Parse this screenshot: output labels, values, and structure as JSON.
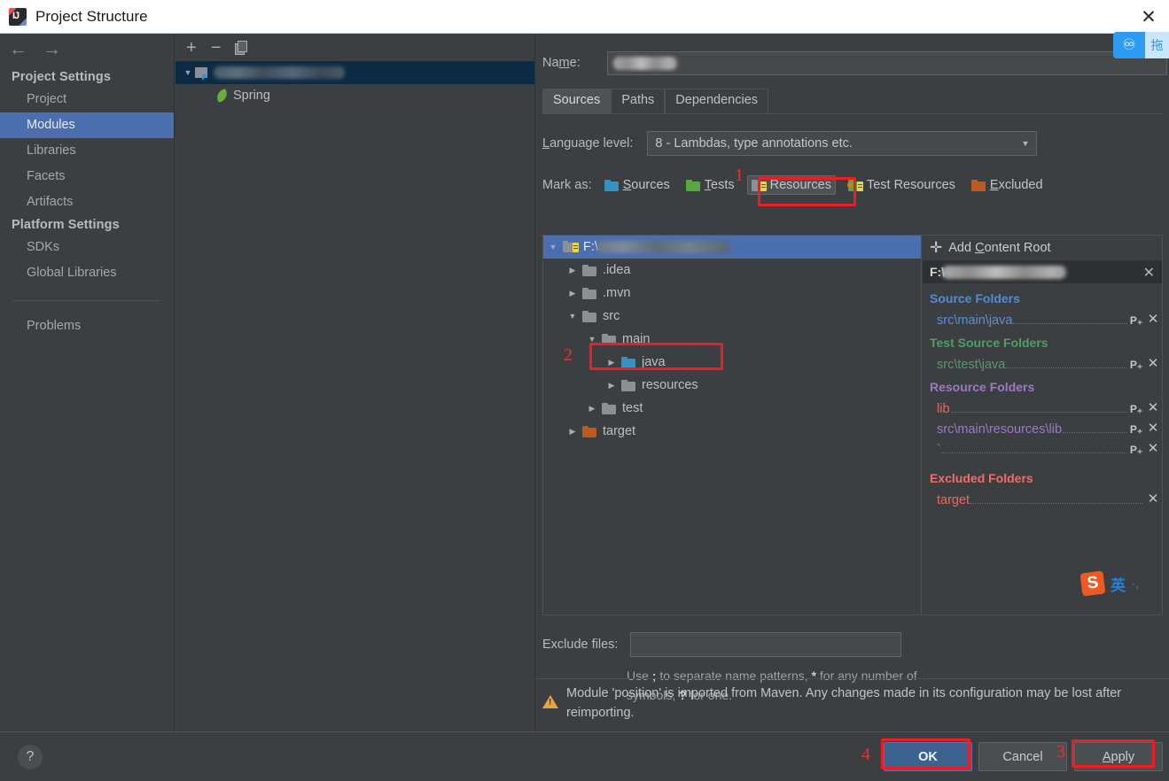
{
  "window": {
    "title": "Project Structure",
    "logo_icon": "intellij-idea-logo-icon",
    "close_icon": "close-icon"
  },
  "nav": {
    "back_icon": "arrow-left-icon",
    "forward_icon": "arrow-right-icon"
  },
  "sidebar": {
    "groups": [
      {
        "label": "Project Settings",
        "items": [
          "Project",
          "Modules",
          "Libraries",
          "Facets",
          "Artifacts"
        ]
      },
      {
        "label": "Platform Settings",
        "items": [
          "SDKs",
          "Global Libraries"
        ]
      }
    ],
    "selected": "Modules",
    "extra_items": [
      "Problems"
    ]
  },
  "module_pane": {
    "toolbar": {
      "add_icon": "plus-icon",
      "remove_icon": "minus-icon",
      "copy_icon": "copy-icon"
    },
    "tree": [
      {
        "label": "",
        "redacted": true,
        "icon": "module-icon",
        "expanded": true,
        "selected": true,
        "indent": 0
      },
      {
        "label": "Spring",
        "redacted": false,
        "icon": "spring-leaf-icon",
        "expanded": null,
        "selected": false,
        "indent": 1
      }
    ]
  },
  "main": {
    "name_label": "Na<u>m</u>e:",
    "name_value": "",
    "name_redacted": true,
    "tabs": [
      {
        "label": "Sources",
        "active": true
      },
      {
        "label": "Paths",
        "active": false
      },
      {
        "label": "Dependencies",
        "active": false
      }
    ],
    "language_level_label": "<u>L</u>anguage level:",
    "language_level_value": "8 - Lambdas, type annotations etc.",
    "mark_as_label": "Mark as:",
    "mark_as_options": [
      {
        "label": "<u>S</u>ources",
        "color": "teal",
        "pressed": false
      },
      {
        "label": "<u>T</u>ests",
        "color": "green",
        "pressed": false
      },
      {
        "label": "Resources",
        "color": "grey-lines",
        "pressed": true
      },
      {
        "label": "Test Resources",
        "color": "green-lines-dot",
        "pressed": false
      },
      {
        "label": "<u>E</u>xcluded",
        "color": "orange",
        "pressed": false
      }
    ],
    "exclude_files_label": "Exclude files:",
    "exclude_files_value": "",
    "exclude_files_hint_1": "Use ",
    "exclude_files_hint_semi": ";",
    "exclude_files_hint_2": " to separate name patterns, ",
    "exclude_files_hint_star": "*",
    "exclude_files_hint_3": " for any number of symbols, ",
    "exclude_files_hint_q": "?",
    "exclude_files_hint_4": " for one.",
    "warning_icon": "warning-triangle-icon",
    "warning_text": "Module 'position' is imported from Maven. Any changes made in its configuration may be lost after reimporting."
  },
  "content_tree": [
    {
      "label": "F:\\",
      "redacted": true,
      "icon": "content-root-icon",
      "state": "expanded",
      "indent": 0,
      "selected": true
    },
    {
      "label": ".idea",
      "icon": "folder-grey-icon",
      "state": "collapsed",
      "indent": 1,
      "selected": false
    },
    {
      "label": ".mvn",
      "icon": "folder-grey-icon",
      "state": "collapsed",
      "indent": 1,
      "selected": false
    },
    {
      "label": "src",
      "icon": "folder-grey-icon",
      "state": "expanded",
      "indent": 1,
      "selected": false
    },
    {
      "label": "main",
      "icon": "folder-grey-icon",
      "state": "expanded",
      "indent": 2,
      "selected": false
    },
    {
      "label": "java",
      "icon": "folder-teal-icon",
      "state": "collapsed",
      "indent": 3,
      "selected": false
    },
    {
      "label": "resources",
      "icon": "folder-grey-icon",
      "state": "collapsed",
      "indent": 3,
      "selected": false,
      "annotated": true
    },
    {
      "label": "test",
      "icon": "folder-grey-icon",
      "state": "collapsed",
      "indent": 2,
      "selected": false
    },
    {
      "label": "target",
      "icon": "folder-orange-icon",
      "state": "collapsed",
      "indent": 1,
      "selected": false
    }
  ],
  "roots_panel": {
    "add_content_root_label": "Add <u>C</u>ontent Root",
    "add_icon": "plus-icon",
    "content_root": {
      "prefix": "F:\\",
      "redacted": true,
      "remove_icon": "close-icon"
    },
    "groups": [
      {
        "title": "Source Folders",
        "kind": "src",
        "entries": [
          {
            "path": "src\\main\\java",
            "invalid": false,
            "has_package_prefix": true
          }
        ]
      },
      {
        "title": "Test Source Folders",
        "kind": "test",
        "entries": [
          {
            "path": "src\\test\\java",
            "invalid": false,
            "has_package_prefix": true
          }
        ]
      },
      {
        "title": "Resource Folders",
        "kind": "res",
        "entries": [
          {
            "path": "lib",
            "invalid": true,
            "has_package_prefix": true
          },
          {
            "path": "src\\main\\resources\\lib",
            "invalid": false,
            "has_package_prefix": true
          },
          {
            "path": "`",
            "invalid": false,
            "has_package_prefix": true
          }
        ]
      },
      {
        "title": "Excluded Folders",
        "kind": "exc",
        "entries": [
          {
            "path": "target",
            "invalid": false,
            "has_package_prefix": false
          }
        ]
      }
    ],
    "package_prefix_icon": "package-prefix-icon",
    "remove_icon": "close-icon"
  },
  "footer": {
    "help_label": "?",
    "ok_label": "OK",
    "cancel_label": "Cancel",
    "apply_label": "<u>A</u>pply"
  },
  "annotations": [
    {
      "number": "1",
      "target": "mark-as-resources-button"
    },
    {
      "number": "2",
      "target": "content-tree-resources-folder"
    },
    {
      "number": "3",
      "target": "apply-button"
    },
    {
      "number": "4",
      "target": "ok-button"
    }
  ],
  "overlays": {
    "baidu": {
      "icon": "baidu-netdisk-icon",
      "tooltip_text": "拖"
    },
    "sogou": {
      "logo": "S",
      "mode_label": "英",
      "extra": "·,"
    }
  },
  "colors": {
    "accent_selection": "#4b6eaf",
    "annotation_red": "#ee1c25",
    "primary_button": "#3c638f",
    "source_blue": "#4e8cd9",
    "test_green": "#4f9e63",
    "resource_purple": "#9b79c6",
    "excluded_red": "#f06c6c",
    "warning_amber": "#e8a33d",
    "window_bg": "#3c3f41"
  }
}
